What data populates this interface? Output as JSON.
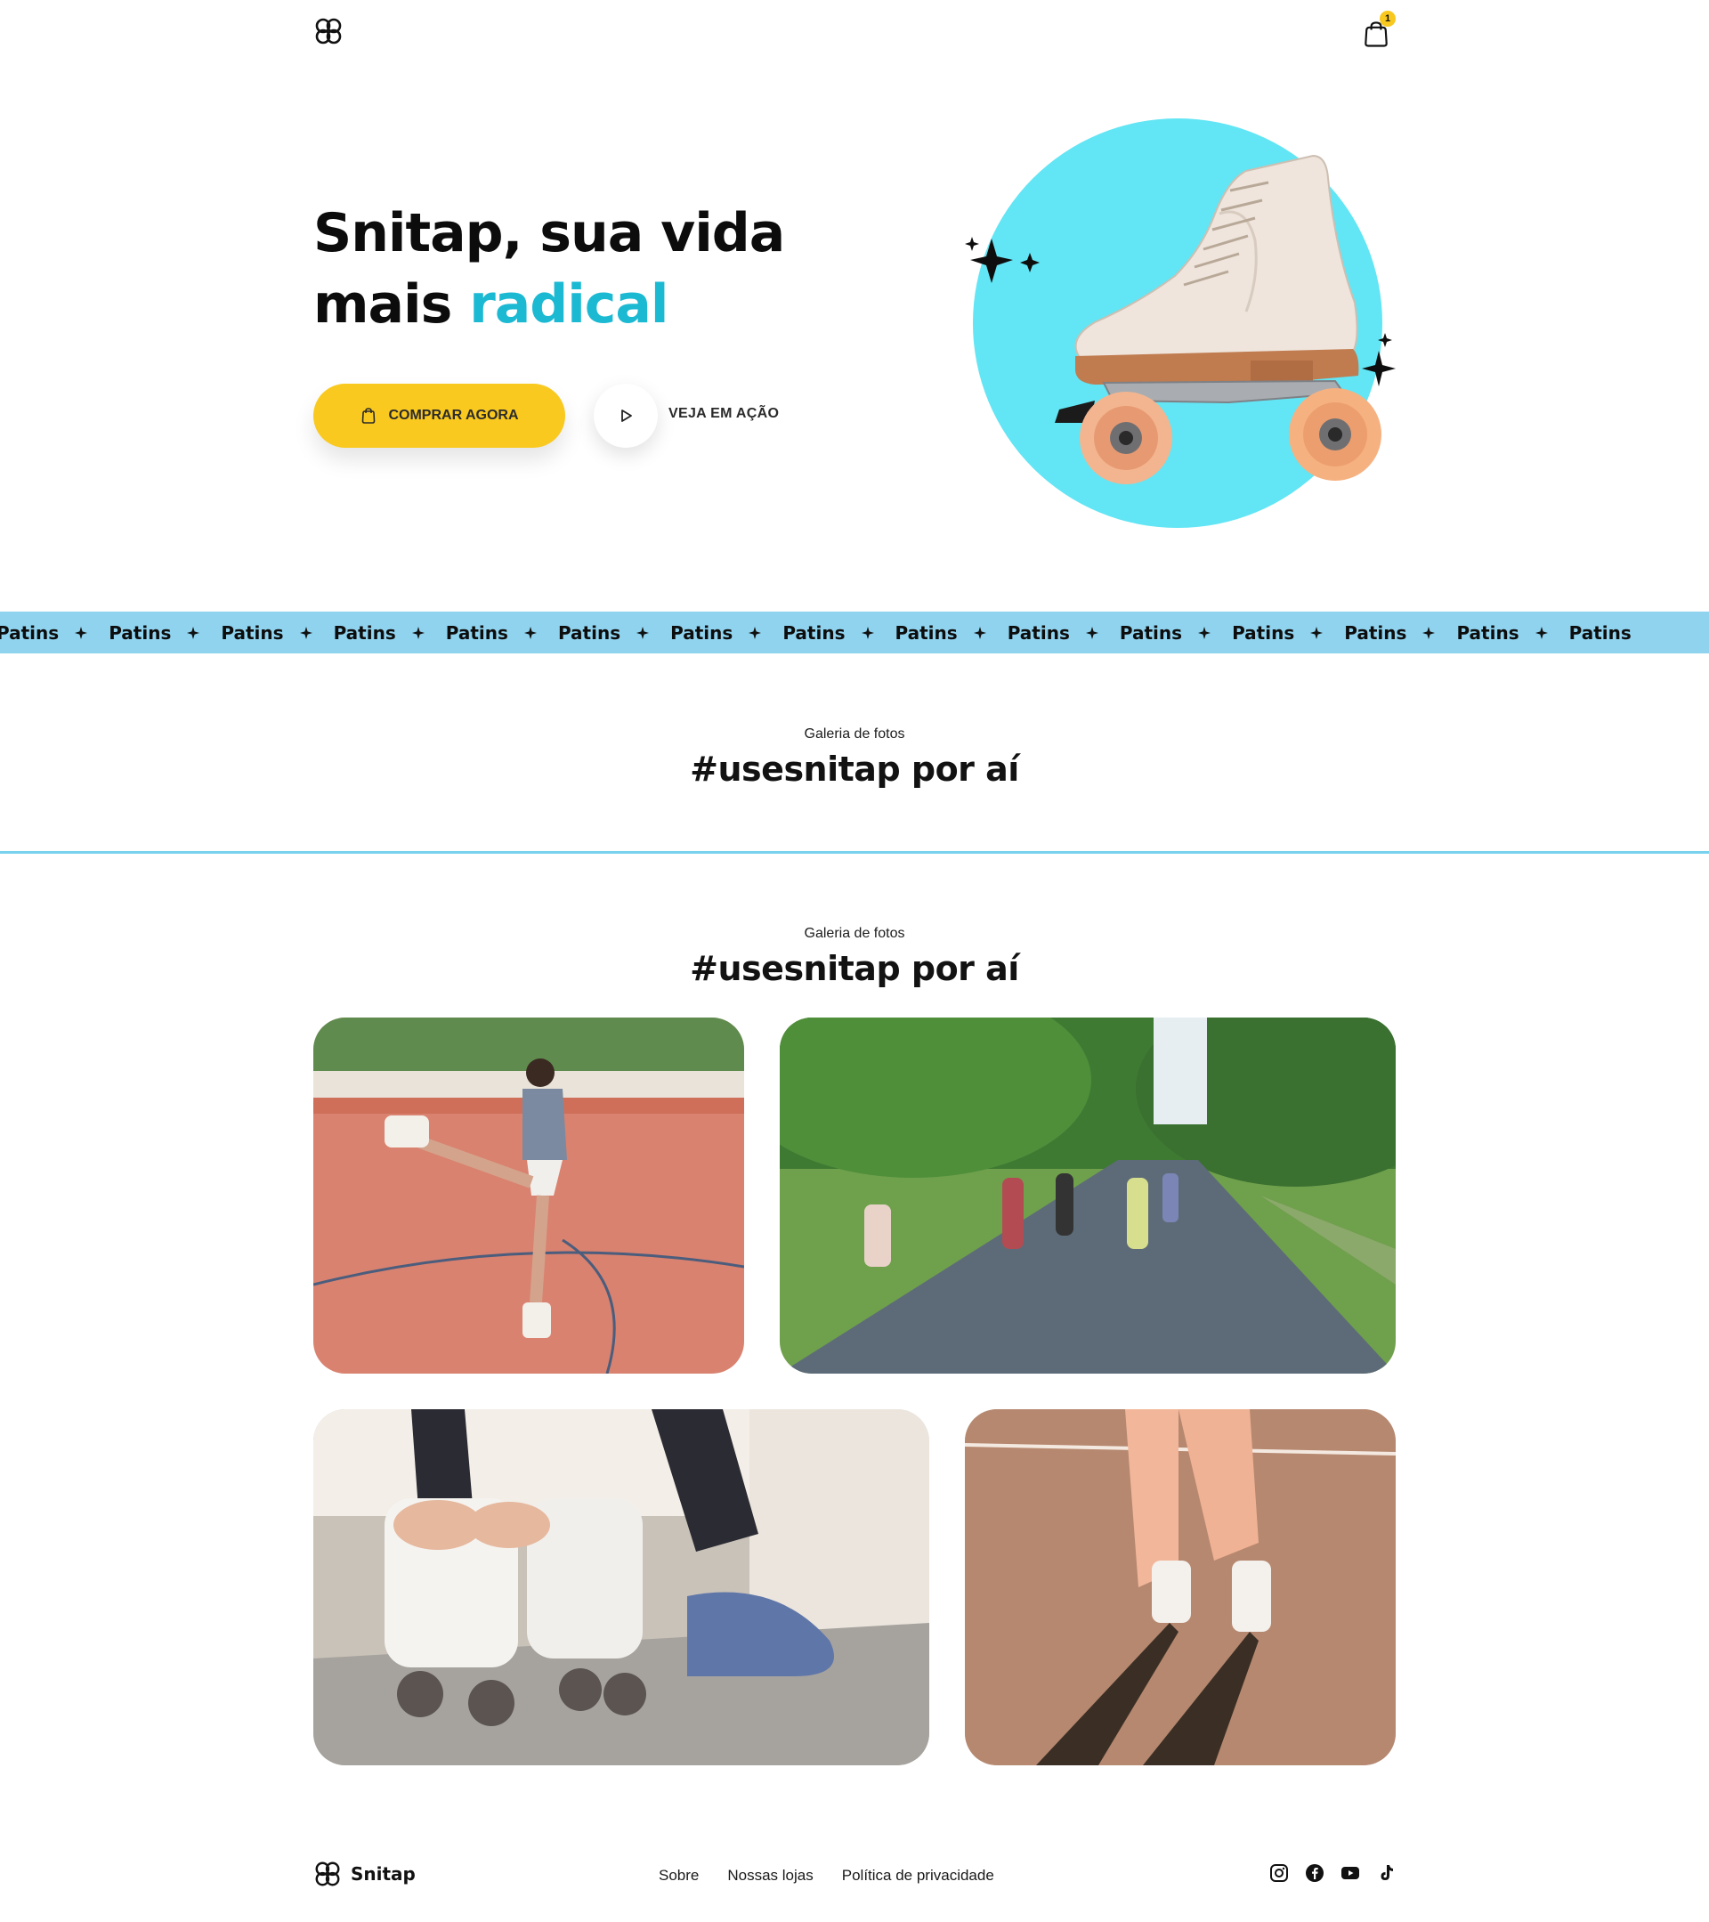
{
  "brand": {
    "name": "Snitap"
  },
  "header": {
    "cart_count": "1"
  },
  "hero": {
    "title_line1": "Snitap, sua vida",
    "title_line2_plain": "mais ",
    "title_line2_accent": "radical",
    "buy_label": "COMPRAR AGORA",
    "play_label": "VEJA EM AÇÃO"
  },
  "marquee": {
    "word": "Patins",
    "items": [
      "Patins",
      "Patins",
      "Patins",
      "Patins",
      "Patins",
      "Patins",
      "Patins",
      "Patins",
      "Patins",
      "Patins",
      "Patins",
      "Patins",
      "Patins",
      "Patins",
      "Patins"
    ]
  },
  "section1": {
    "kicker": "Galeria de fotos",
    "title": "#usesnitap por aí"
  },
  "section2": {
    "kicker": "Galeria de fotos",
    "title": "#usesnitap por aí"
  },
  "footer": {
    "brand": "Snitap",
    "links": [
      "Sobre",
      "Nossas lojas",
      "Política de privacidade"
    ],
    "social": [
      "instagram-icon",
      "facebook-icon",
      "youtube-icon",
      "tiktok-icon"
    ]
  },
  "colors": {
    "accent": "#1cb9d3",
    "button": "#f9c91f",
    "band": "#8fd3ef",
    "circle": "#62e5f4"
  }
}
